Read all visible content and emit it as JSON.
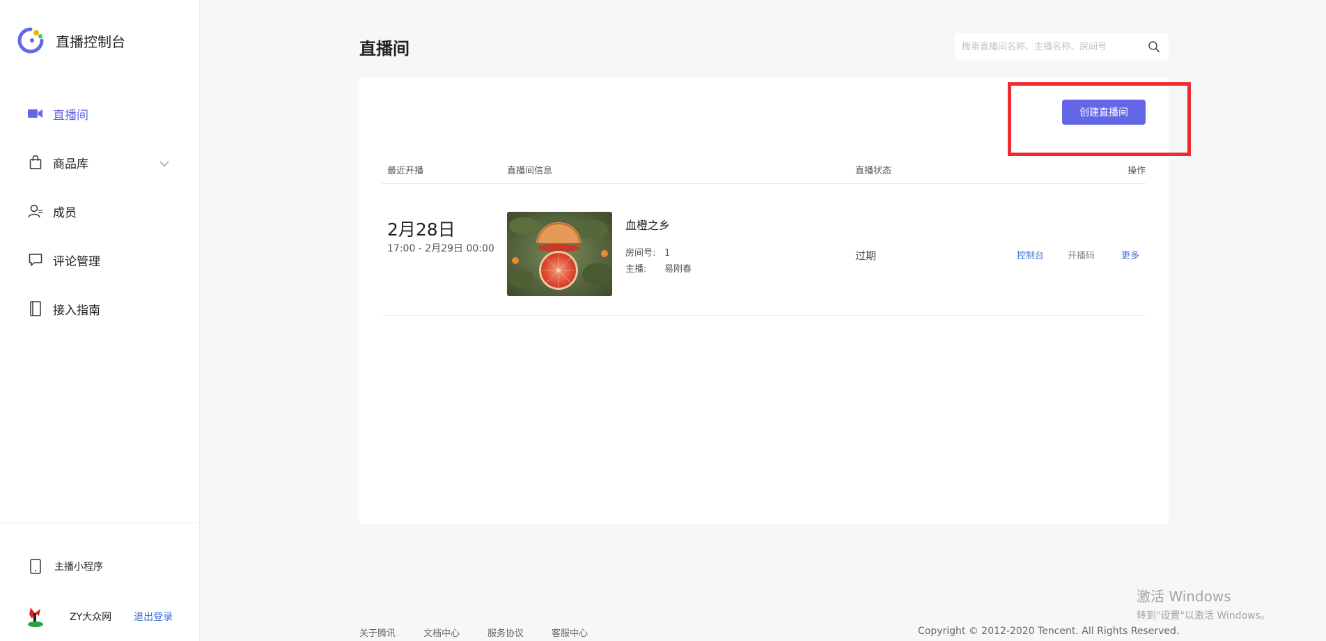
{
  "app": {
    "title": "直播控制台"
  },
  "nav": {
    "items": [
      {
        "label": "直播间",
        "icon": "video-camera-icon",
        "active": true
      },
      {
        "label": "商品库",
        "icon": "shopping-bag-icon",
        "active": false
      },
      {
        "label": "成员",
        "icon": "user-icon",
        "active": false
      },
      {
        "label": "评论管理",
        "icon": "comment-icon",
        "active": false
      },
      {
        "label": "接入指南",
        "icon": "book-icon",
        "active": false
      }
    ]
  },
  "sidebar_footer": {
    "mini_program": "主播小程序",
    "username": "ZY大众网",
    "logout": "退出登录"
  },
  "header": {
    "title": "直播间",
    "search_placeholder": "搜索直播间名称、主播名称、房间号"
  },
  "toolbar": {
    "create_label": "创建直播间"
  },
  "table": {
    "columns": [
      "最近开播",
      "直播间信息",
      "直播状态",
      "操作"
    ],
    "rows": [
      {
        "date": "2月28日",
        "time_range": "17:00 - 2月29日 00:00",
        "name": "血橙之乡",
        "room_label": "房间号:",
        "room_no": "1",
        "host_label": "主播:",
        "host": "易刚春",
        "status": "过期",
        "actions": [
          "控制台",
          "开播码",
          "更多"
        ]
      }
    ]
  },
  "footer": {
    "links": [
      "关于腾讯",
      "文档中心",
      "服务协议",
      "客服中心"
    ],
    "copyright": "Copyright © 2012-2020 Tencent. All Rights Reserved."
  },
  "os_overlay": {
    "line1": "激活 Windows",
    "line2": "转到\"设置\"以激活 Windows。"
  },
  "colors": {
    "accent": "#6367e6",
    "link": "#3a6ed6",
    "highlight": "#ee2b2f"
  }
}
